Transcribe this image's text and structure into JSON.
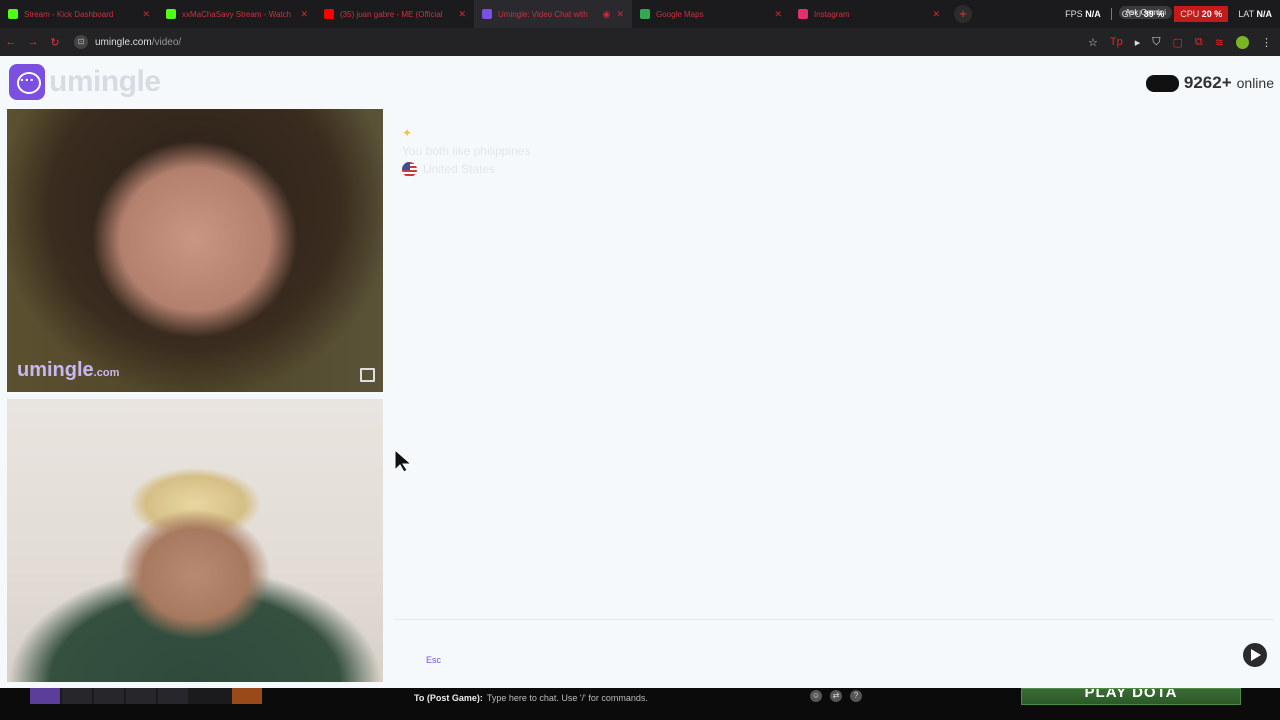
{
  "browser": {
    "tabs": [
      {
        "title": "Stream - Kick Dashboard",
        "favicon_color": "#53fc18"
      },
      {
        "title": "xxMaChaSavy Stream - Watch",
        "favicon_color": "#53fc18"
      },
      {
        "title": "(35) juan gabre - ME (Official",
        "favicon_color": "#ff0000"
      },
      {
        "title": "Umingle: Video Chat with",
        "favicon_color": "#7b4fe0"
      },
      {
        "title": "Google Maps",
        "favicon_color": "#34a853"
      },
      {
        "title": "Instagram",
        "favicon_color": "#e1306c"
      }
    ],
    "new_tab": "+",
    "ask_gemini": "Ask Gemini",
    "url_host": "umingle.com",
    "url_path": "/video/",
    "stats": {
      "fps_label": "FPS",
      "fps_value": "N/A",
      "gpu_label": "GPU",
      "gpu_value": "39 %",
      "cpu_label": "CPU",
      "cpu_value": "20 %",
      "lat_label": "LAT",
      "lat_value": "N/A"
    }
  },
  "page": {
    "logo_text": "umingle",
    "online_count": "9262+",
    "online_label": "online",
    "stranger_video": {
      "watermark": "umingle",
      "watermark_suffix": ".com"
    },
    "chat": {
      "messages": [
        "You both like philippines",
        "United States"
      ]
    },
    "input": {
      "hint": "Esc"
    }
  },
  "game": {
    "chat_target": "To (Post Game):",
    "chat_placeholder": "Type here to chat. Use '/' for commands.",
    "play_button": "PLAY DOTA"
  },
  "colors": {
    "accent": "#7b4fe0",
    "play_green": "#2b5a28"
  }
}
